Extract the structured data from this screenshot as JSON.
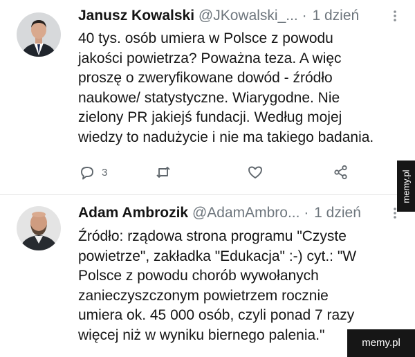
{
  "tweets": [
    {
      "name": "Janusz Kowalski",
      "handle": "@JKowalski_...",
      "separator": "·",
      "time": "1 dzień",
      "text": "40 tys. osób umiera w Polsce z powodu\njakości powietrza? Poważna teza. A więc\nproszę o zweryfikowane dowód - źródło\nnaukowe/ statystyczne. Wiarygodne. Nie\nzielony PR jakiejś fundacji. Według mojej\nwiedzy to nadużycie i nie ma takiego badania.",
      "reply_count": "3",
      "icons": [
        "reply-icon",
        "retweet-icon",
        "like-icon",
        "share-icon",
        "more-icon"
      ]
    },
    {
      "name": "Adam Ambrozik",
      "handle": "@AdamAmbro...",
      "separator": "·",
      "time": "1 dzień",
      "text": "Źródło: rządowa strona programu \"Czyste\npowietrze\", zakładka \"Edukacja\" :-) cyt.: \"W\nPolsce z powodu chorób wywołanych\nzanieczyszczonym powietrzem rocznie\numiera ok. 45 000 osób, czyli ponad 7 razy\nwięcej niż w wyniku biernego palenia.\"",
      "icons": [
        "more-icon"
      ]
    }
  ],
  "watermarks": {
    "side": "memy.pl",
    "bottom": "memy.pl"
  }
}
